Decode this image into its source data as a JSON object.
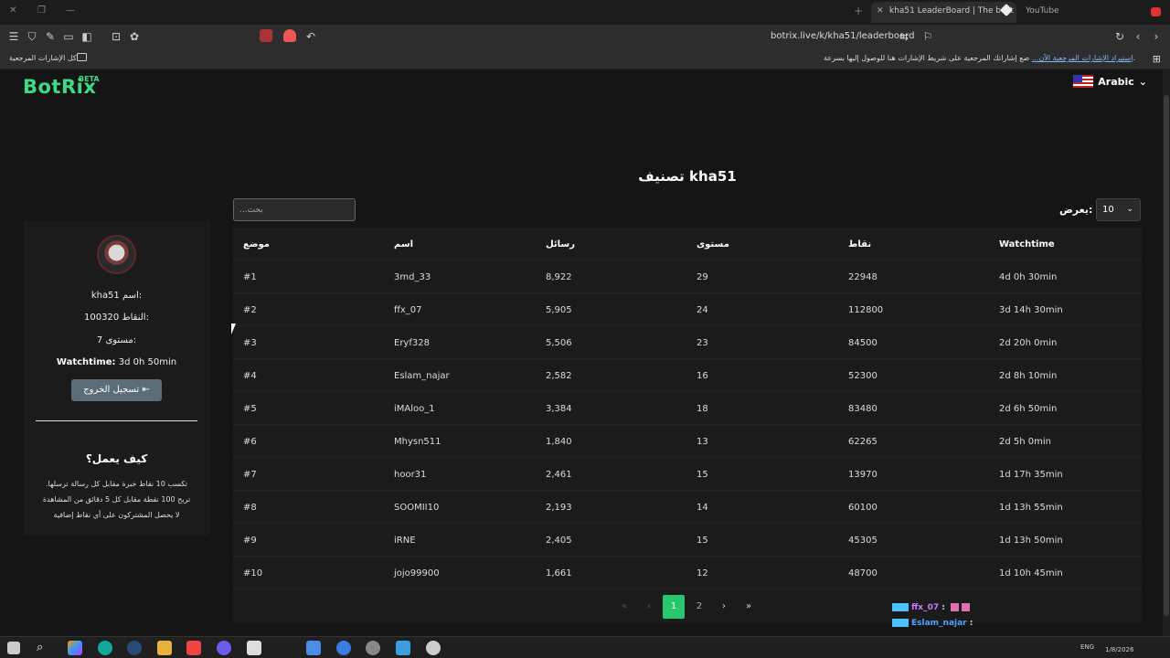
{
  "browser": {
    "active_tab": "kha51 LeaderBoard | The best C...",
    "other_tab": "YouTube",
    "url": "botrix.live/k/kha51/leaderboard",
    "bookmarks_all": "كل الإشارات المرجعية",
    "bookmarks_hint": "ضع إشاراتك المرجعية على شريط الإشارات هنا للوصول إليها بسرعة.",
    "bookmarks_import": "إستيراد الإشارات المرجعية الآن..."
  },
  "site": {
    "logo": "BotRix",
    "beta": "BETA",
    "language": "Arabic"
  },
  "page": {
    "title": "تصنيف kha51",
    "search_placeholder": "بحث...",
    "show_label": "يعرض:",
    "show_value": "10"
  },
  "table": {
    "headers": [
      "موضع",
      "اسم",
      "رسائل",
      "مستوى",
      "نقاط",
      "Watchtime"
    ],
    "rows": [
      [
        "#1",
        "3md_33",
        "8,922",
        "29",
        "22948",
        "4d 0h 30min"
      ],
      [
        "#2",
        "ffx_07",
        "5,905",
        "24",
        "112800",
        "3d 14h 30min"
      ],
      [
        "#3",
        "Eryf328",
        "5,506",
        "23",
        "84500",
        "2d 20h 0min"
      ],
      [
        "#4",
        "Eslam_najar",
        "2,582",
        "16",
        "52300",
        "2d 8h 10min"
      ],
      [
        "#5",
        "iMAloo_1",
        "3,384",
        "18",
        "83480",
        "2d 6h 50min"
      ],
      [
        "#6",
        "Mhysn511",
        "1,840",
        "13",
        "62265",
        "2d 5h 0min"
      ],
      [
        "#7",
        "hoor31",
        "2,461",
        "15",
        "13970",
        "1d 17h 35min"
      ],
      [
        "#8",
        "SOOMII10",
        "2,193",
        "14",
        "60100",
        "1d 13h 55min"
      ],
      [
        "#9",
        "iRNE",
        "2,405",
        "15",
        "45305",
        "1d 13h 50min"
      ],
      [
        "#10",
        "jojo99900",
        "1,661",
        "12",
        "48700",
        "1d 10h 45min"
      ]
    ]
  },
  "pagination": {
    "first": "«",
    "prev": "‹",
    "page1": "1",
    "page2": "2",
    "next": "›",
    "last": "»"
  },
  "profile": {
    "name_line": "kha51 اسم:",
    "points_line": "100320 النقاط:",
    "level_line": "7 مستوى:",
    "watch_label": "Watchtime:",
    "watch_value": "3d 0h 50min",
    "logout": "تسجيل الخروج",
    "how_title": "كيف يعمل؟",
    "rules": [
      "تكسب 10 نقاط خبرة مقابل كل رسالة ترسلها.",
      "تربح 100 نقطة مقابل كل 5 دقائق من المشاهدة",
      "لا يحصل المشتركون على أي نقاط إضافية"
    ]
  },
  "chat": {
    "user1": "ffx_07",
    "user2": "Eslam_najar"
  },
  "taskbar": {
    "lang": "ENG",
    "date": "1/8/2026"
  },
  "colors": {
    "accent": "#3ddc84",
    "active_page": "#28c76f",
    "logout_button": "#5b6d78"
  }
}
